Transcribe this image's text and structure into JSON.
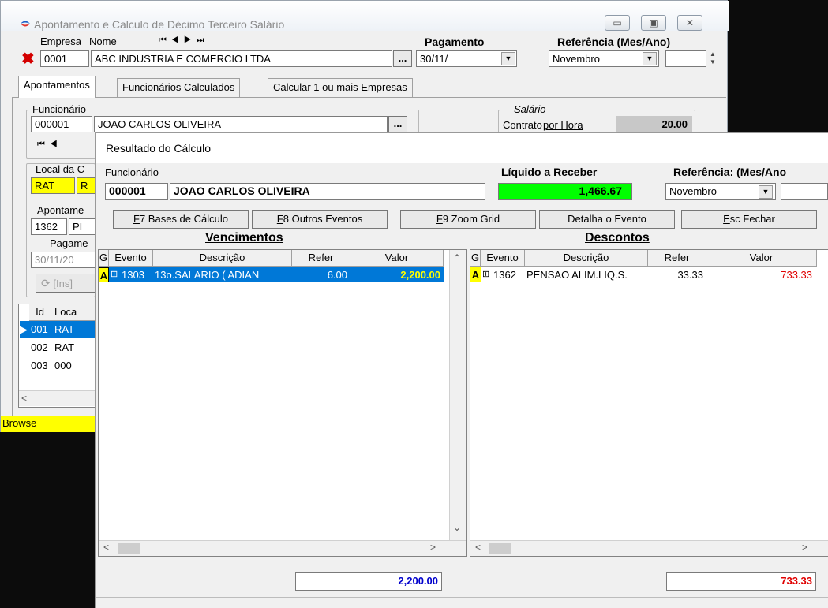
{
  "window": {
    "title": "Apontamento e Calculo de Décimo Terceiro Salário",
    "buttons": {
      "minimize": "▭",
      "maximize": "▣",
      "close": "✕"
    }
  },
  "header": {
    "empresa_label": "Empresa",
    "nome_label": "Nome",
    "nav_first": "⏮",
    "nav_prev": "◀",
    "nav_next": "▶",
    "nav_last": "⏭",
    "empresa_code": "0001",
    "empresa_name": "ABC INDUSTRIA E COMERCIO LTDA",
    "ellipsis": "...",
    "pagamento_label": "Pagamento",
    "pagamento_value": "30/11/",
    "referencia_label": "Referência (Mes/Ano)",
    "referencia_month": "Novembro",
    "referencia_year": ""
  },
  "tabs": [
    {
      "label": "Apontamentos"
    },
    {
      "label": "Funcionários Calculados"
    },
    {
      "label": "Calcular 1 ou mais Empresas"
    }
  ],
  "funcionario": {
    "group_label": "Funcionário",
    "code": "000001",
    "name": "JOAO CARLOS OLIVEIRA",
    "ellipsis": "..."
  },
  "salario": {
    "group_label": "Salário",
    "contrato_label": "Contrato",
    "contrato_link": "por Hora",
    "value": "20.00"
  },
  "background_panel": {
    "local_label": "Local da C",
    "local_chip1": "RAT",
    "local_chip2": "R",
    "apontamento_label": "Apontame",
    "apontamento_code": "1362",
    "apontamento_rest": "PI",
    "pagamento_label": "Pagame",
    "pagamento_value": "30/11/20",
    "insert_label": "[Ins]",
    "table_headers": [
      "Id",
      "Loca"
    ],
    "table_rows": [
      {
        "id": "001",
        "loc": "RAT"
      },
      {
        "id": "002",
        "loc": "RAT"
      },
      {
        "id": "003",
        "loc": "000"
      }
    ],
    "status": "Browse"
  },
  "dialog": {
    "title": "Resultado do Cálculo",
    "funcionario_label": "Funcionário",
    "funcionario_code": "000001",
    "funcionario_name": "JOAO CARLOS OLIVEIRA",
    "liquido_label": "Líquido a Receber",
    "liquido_value": "1,466.67",
    "referencia_label": "Referência: (Mes/Ano",
    "referencia_month": "Novembro",
    "buttons": {
      "f7_key": "F",
      "f7_rest": "7 Bases de Cálculo",
      "f8_key": "F",
      "f8_rest": "8 Outros Eventos",
      "f9_key": "F",
      "f9_rest": "9 Zoom Grid",
      "detalha": "Detalha o Evento",
      "esc_key": "E",
      "esc_rest": "sc Fechar"
    },
    "vencimentos": {
      "title": "Vencimentos",
      "headers": [
        "G",
        "Evento",
        "Descrição",
        "Refer",
        "Valor"
      ],
      "rows": [
        {
          "g": "A",
          "evento": "1303",
          "descricao": "13o.SALARIO ( ADIAN",
          "refer": "6.00",
          "valor": "2,200.00"
        }
      ],
      "total": "2,200.00"
    },
    "descontos": {
      "title": "Descontos",
      "headers": [
        "G",
        "Evento",
        "Descrição",
        "Refer",
        "Valor"
      ],
      "rows": [
        {
          "g": "A",
          "evento": "1362",
          "descricao": "PENSAO ALIM.LIQ.S.",
          "refer": "33.33",
          "valor": "733.33"
        }
      ],
      "total": "733.33"
    }
  },
  "colors": {
    "liquido_bg": "#00ff00",
    "selected_row": "#0078d7",
    "highlight_yellow": "#ffff00",
    "descontos_value": "#e00000",
    "total_vencimentos": "#0000cc",
    "total_descontos": "#e00000"
  }
}
